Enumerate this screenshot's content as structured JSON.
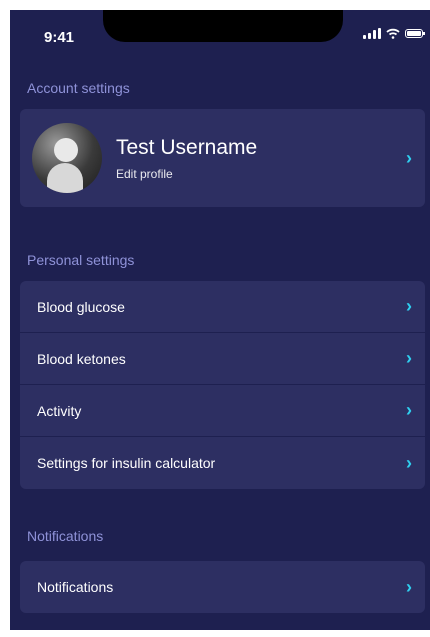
{
  "status_bar": {
    "time": "9:41"
  },
  "account_section": {
    "title": "Account settings",
    "profile": {
      "name": "Test Username",
      "edit_label": "Edit profile"
    }
  },
  "personal_section": {
    "title": "Personal settings",
    "items": [
      {
        "label": "Blood glucose"
      },
      {
        "label": "Blood ketones"
      },
      {
        "label": "Activity"
      },
      {
        "label": "Settings for insulin calculator"
      }
    ]
  },
  "notifications_section": {
    "title": "Notifications",
    "items": [
      {
        "label": "Notifications"
      }
    ]
  },
  "colors": {
    "background": "#1e2050",
    "card": "#2d2f62",
    "section_title": "#8f92d8",
    "chevron": "#2fd0f0"
  },
  "icons": {
    "row_chevron": "chevron-right-icon"
  }
}
